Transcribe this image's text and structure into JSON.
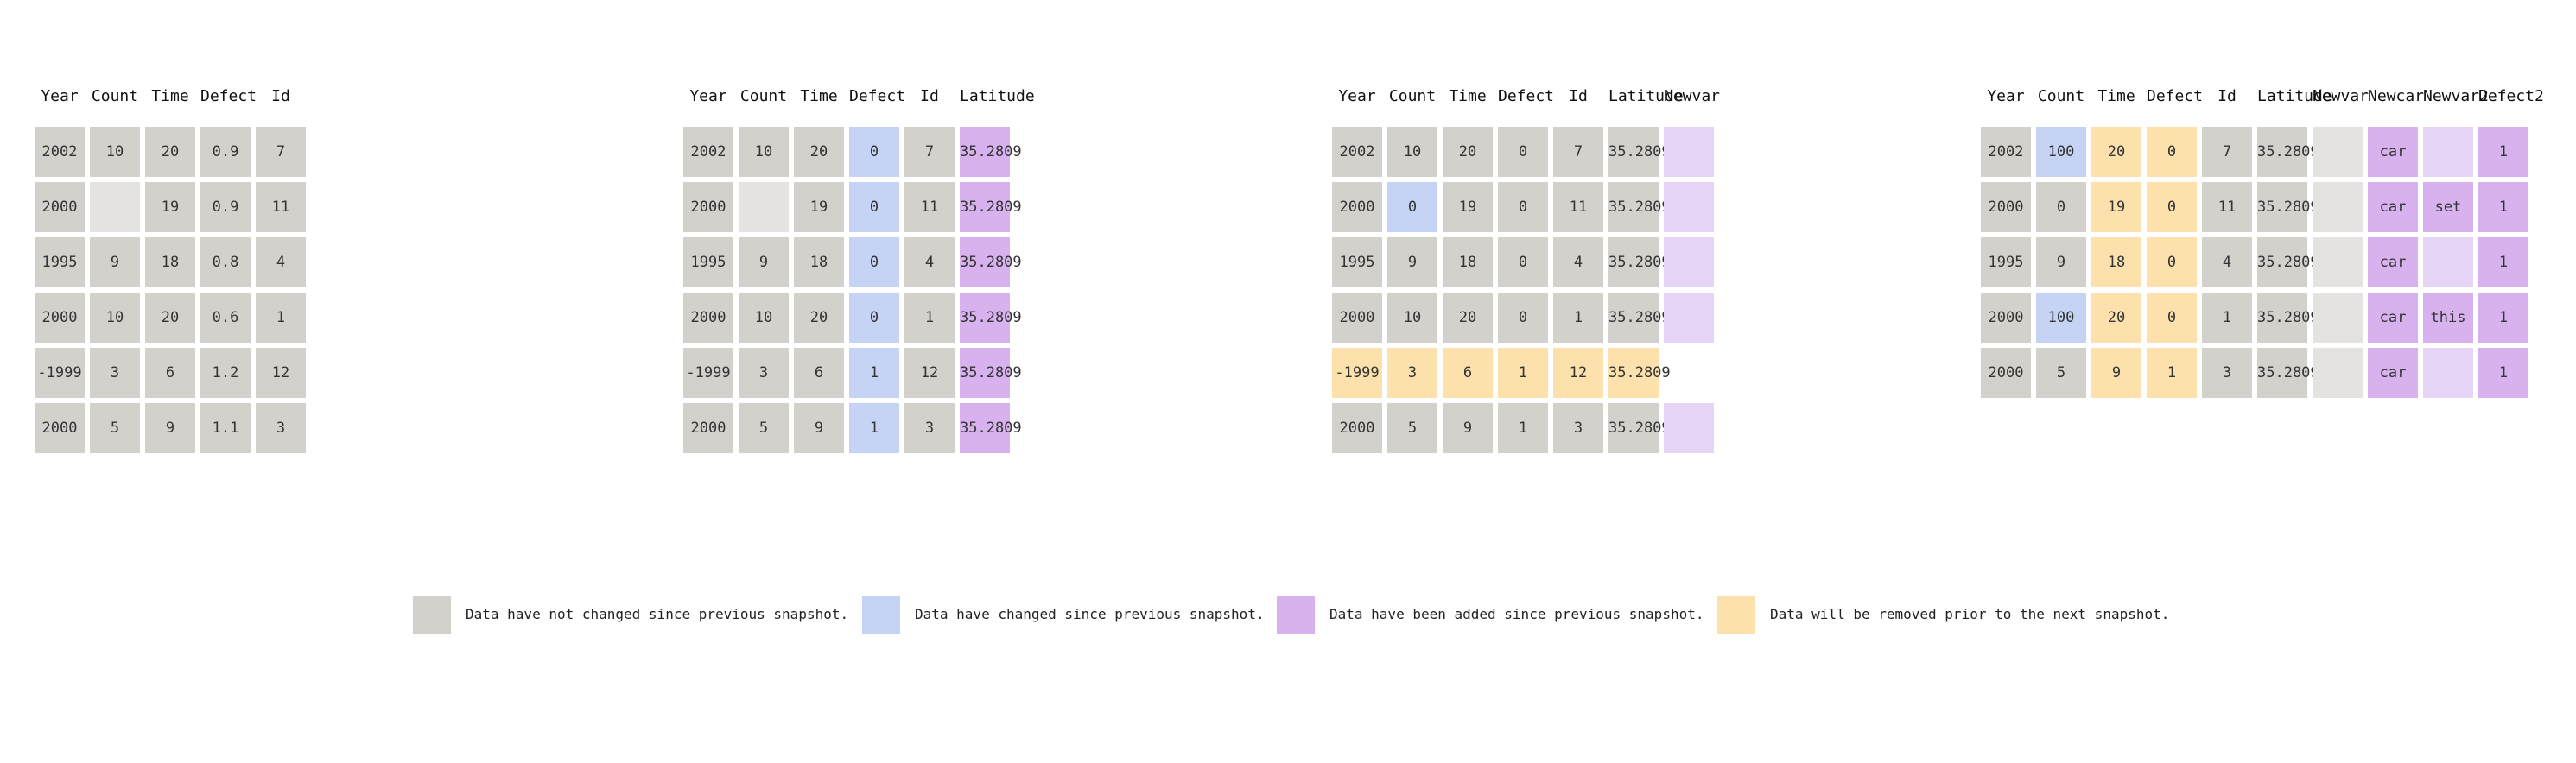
{
  "colors": {
    "same": "#d2d1cc",
    "missing": "#e4e3df",
    "changed": "#c5d3f5",
    "added": "#d7b2ee",
    "added-missing": "#e6d5f6",
    "removed": "#fde1ad"
  },
  "snapshots": [
    {
      "columns": [
        "Year",
        "Count",
        "Time",
        "Defect",
        "Id"
      ],
      "rows": [
        {
          "cells": [
            [
              "2002",
              "same"
            ],
            [
              "10",
              "same"
            ],
            [
              "20",
              "same"
            ],
            [
              "0.9",
              "same"
            ],
            [
              "7",
              "same"
            ]
          ]
        },
        {
          "cells": [
            [
              "2000",
              "same"
            ],
            [
              "",
              "missing"
            ],
            [
              "19",
              "same"
            ],
            [
              "0.9",
              "same"
            ],
            [
              "11",
              "same"
            ]
          ]
        },
        {
          "cells": [
            [
              "1995",
              "same"
            ],
            [
              "9",
              "same"
            ],
            [
              "18",
              "same"
            ],
            [
              "0.8",
              "same"
            ],
            [
              "4",
              "same"
            ]
          ]
        },
        {
          "cells": [
            [
              "2000",
              "same"
            ],
            [
              "10",
              "same"
            ],
            [
              "20",
              "same"
            ],
            [
              "0.6",
              "same"
            ],
            [
              "1",
              "same"
            ]
          ]
        },
        {
          "cells": [
            [
              "-1999",
              "same"
            ],
            [
              "3",
              "same"
            ],
            [
              "6",
              "same"
            ],
            [
              "1.2",
              "same"
            ],
            [
              "12",
              "same"
            ]
          ]
        },
        {
          "cells": [
            [
              "2000",
              "same"
            ],
            [
              "5",
              "same"
            ],
            [
              "9",
              "same"
            ],
            [
              "1.1",
              "same"
            ],
            [
              "3",
              "same"
            ]
          ]
        }
      ]
    },
    {
      "columns": [
        "Year",
        "Count",
        "Time",
        "Defect",
        "Id",
        "Latitude"
      ],
      "rows": [
        {
          "cells": [
            [
              "2002",
              "same"
            ],
            [
              "10",
              "same"
            ],
            [
              "20",
              "same"
            ],
            [
              "0",
              "changed"
            ],
            [
              "7",
              "same"
            ],
            [
              "35.2809",
              "added"
            ]
          ]
        },
        {
          "cells": [
            [
              "2000",
              "same"
            ],
            [
              "",
              "missing"
            ],
            [
              "19",
              "same"
            ],
            [
              "0",
              "changed"
            ],
            [
              "11",
              "same"
            ],
            [
              "35.2809",
              "added"
            ]
          ]
        },
        {
          "cells": [
            [
              "1995",
              "same"
            ],
            [
              "9",
              "same"
            ],
            [
              "18",
              "same"
            ],
            [
              "0",
              "changed"
            ],
            [
              "4",
              "same"
            ],
            [
              "35.2809",
              "added"
            ]
          ]
        },
        {
          "cells": [
            [
              "2000",
              "same"
            ],
            [
              "10",
              "same"
            ],
            [
              "20",
              "same"
            ],
            [
              "0",
              "changed"
            ],
            [
              "1",
              "same"
            ],
            [
              "35.2809",
              "added"
            ]
          ]
        },
        {
          "cells": [
            [
              "-1999",
              "same"
            ],
            [
              "3",
              "same"
            ],
            [
              "6",
              "same"
            ],
            [
              "1",
              "changed"
            ],
            [
              "12",
              "same"
            ],
            [
              "35.2809",
              "added"
            ]
          ]
        },
        {
          "cells": [
            [
              "2000",
              "same"
            ],
            [
              "5",
              "same"
            ],
            [
              "9",
              "same"
            ],
            [
              "1",
              "changed"
            ],
            [
              "3",
              "same"
            ],
            [
              "35.2809",
              "added"
            ]
          ]
        }
      ]
    },
    {
      "columns": [
        "Year",
        "Count",
        "Time",
        "Defect",
        "Id",
        "Latitude",
        "Newvar"
      ],
      "rows": [
        {
          "cells": [
            [
              "2002",
              "same"
            ],
            [
              "10",
              "same"
            ],
            [
              "20",
              "same"
            ],
            [
              "0",
              "same"
            ],
            [
              "7",
              "same"
            ],
            [
              "35.2809",
              "same"
            ],
            [
              "",
              "added-missing"
            ]
          ]
        },
        {
          "cells": [
            [
              "2000",
              "same"
            ],
            [
              "0",
              "changed"
            ],
            [
              "19",
              "same"
            ],
            [
              "0",
              "same"
            ],
            [
              "11",
              "same"
            ],
            [
              "35.2809",
              "same"
            ],
            [
              "",
              "added-missing"
            ]
          ]
        },
        {
          "cells": [
            [
              "1995",
              "same"
            ],
            [
              "9",
              "same"
            ],
            [
              "18",
              "same"
            ],
            [
              "0",
              "same"
            ],
            [
              "4",
              "same"
            ],
            [
              "35.2809",
              "same"
            ],
            [
              "",
              "added-missing"
            ]
          ]
        },
        {
          "cells": [
            [
              "2000",
              "same"
            ],
            [
              "10",
              "same"
            ],
            [
              "20",
              "same"
            ],
            [
              "0",
              "same"
            ],
            [
              "1",
              "same"
            ],
            [
              "35.2809",
              "same"
            ],
            [
              "",
              "added-missing"
            ]
          ]
        },
        {
          "cells": [
            [
              "-1999",
              "removed"
            ],
            [
              "3",
              "removed"
            ],
            [
              "6",
              "removed"
            ],
            [
              "1",
              "removed"
            ],
            [
              "12",
              "removed"
            ],
            [
              "35.2809",
              "removed"
            ],
            [
              "",
              "none"
            ]
          ]
        },
        {
          "cells": [
            [
              "2000",
              "same"
            ],
            [
              "5",
              "same"
            ],
            [
              "9",
              "same"
            ],
            [
              "1",
              "same"
            ],
            [
              "3",
              "same"
            ],
            [
              "35.2809",
              "same"
            ],
            [
              "",
              "added-missing"
            ]
          ]
        }
      ]
    },
    {
      "columns": [
        "Year",
        "Count",
        "Time",
        "Defect",
        "Id",
        "Latitude",
        "Newvar",
        "Newcar",
        "Newvar2",
        "Defect2"
      ],
      "rows": [
        {
          "cells": [
            [
              "2002",
              "same"
            ],
            [
              "100",
              "changed"
            ],
            [
              "20",
              "removed"
            ],
            [
              "0",
              "removed"
            ],
            [
              "7",
              "same"
            ],
            [
              "35.2809",
              "same"
            ],
            [
              "",
              "missing"
            ],
            [
              "car",
              "added"
            ],
            [
              "",
              "added-missing"
            ],
            [
              "1",
              "added"
            ]
          ]
        },
        {
          "cells": [
            [
              "2000",
              "same"
            ],
            [
              "0",
              "same"
            ],
            [
              "19",
              "removed"
            ],
            [
              "0",
              "removed"
            ],
            [
              "11",
              "same"
            ],
            [
              "35.2809",
              "same"
            ],
            [
              "",
              "missing"
            ],
            [
              "car",
              "added"
            ],
            [
              "set",
              "added"
            ],
            [
              "1",
              "added"
            ]
          ]
        },
        {
          "cells": [
            [
              "1995",
              "same"
            ],
            [
              "9",
              "same"
            ],
            [
              "18",
              "removed"
            ],
            [
              "0",
              "removed"
            ],
            [
              "4",
              "same"
            ],
            [
              "35.2809",
              "same"
            ],
            [
              "",
              "missing"
            ],
            [
              "car",
              "added"
            ],
            [
              "",
              "added-missing"
            ],
            [
              "1",
              "added"
            ]
          ]
        },
        {
          "cells": [
            [
              "2000",
              "same"
            ],
            [
              "100",
              "changed"
            ],
            [
              "20",
              "removed"
            ],
            [
              "0",
              "removed"
            ],
            [
              "1",
              "same"
            ],
            [
              "35.2809",
              "same"
            ],
            [
              "",
              "missing"
            ],
            [
              "car",
              "added"
            ],
            [
              "this",
              "added"
            ],
            [
              "1",
              "added"
            ]
          ]
        },
        {
          "cells": [
            [
              "2000",
              "same"
            ],
            [
              "5",
              "same"
            ],
            [
              "9",
              "removed"
            ],
            [
              "1",
              "removed"
            ],
            [
              "3",
              "same"
            ],
            [
              "35.2809",
              "same"
            ],
            [
              "",
              "missing"
            ],
            [
              "car",
              "added"
            ],
            [
              "",
              "added-missing"
            ],
            [
              "1",
              "added"
            ]
          ]
        }
      ]
    }
  ],
  "legend": [
    {
      "state": "same",
      "label": "Data have not changed since previous snapshot."
    },
    {
      "state": "changed",
      "label": "Data have changed since previous snapshot."
    },
    {
      "state": "added",
      "label": "Data have been added since previous snapshot."
    },
    {
      "state": "removed",
      "label": "Data will be removed prior to the next snapshot."
    }
  ]
}
